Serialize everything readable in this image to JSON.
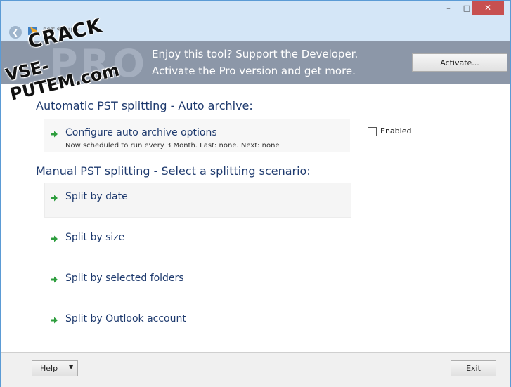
{
  "window": {
    "app_title": "PST Splitter",
    "controls": {
      "minimize": "–",
      "maximize": "□",
      "close": "✕"
    }
  },
  "banner": {
    "watermark": "PRO",
    "line1": "Enjoy this tool? Support the Developer.",
    "line2": "Activate the Pro version and get more.",
    "activate_label": "Activate..."
  },
  "overlay": {
    "crack_line1": "CRACK",
    "crack_line2": "VSE-PUTEM.com"
  },
  "auto_section": {
    "heading": "Automatic PST splitting - Auto archive:",
    "configure_label": "Configure auto archive options",
    "schedule_text": "Now scheduled to run every 3 Month. Last: none. Next: none",
    "enabled_label": "Enabled",
    "enabled": false
  },
  "manual_section": {
    "heading": "Manual PST splitting - Select a splitting scenario:",
    "items": [
      {
        "label": "Split by date"
      },
      {
        "label": "Split by size"
      },
      {
        "label": "Split by selected folders"
      },
      {
        "label": "Split by Outlook account"
      }
    ]
  },
  "footer": {
    "help_label": "Help",
    "exit_label": "Exit"
  },
  "colors": {
    "heading": "#1e3a6e",
    "banner": "#8c97a8",
    "arrow": "#2e9e3e",
    "close_button": "#c75050"
  },
  "icons": {
    "back": "back-arrow-icon",
    "app": "app-logo-icon",
    "item_arrow": "green-arrow-icon"
  }
}
